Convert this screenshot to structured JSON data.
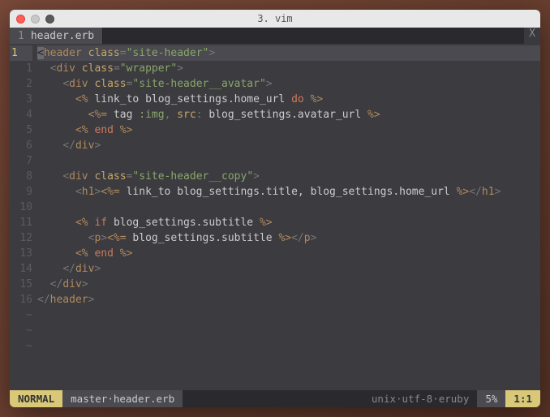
{
  "window": {
    "title": "3. vim"
  },
  "tab": {
    "index": "1",
    "filename": "header.erb",
    "close": "X"
  },
  "gutter": [
    " 1",
    " 2",
    " 3",
    " 4",
    " 5",
    " 6",
    " 7",
    " 8",
    " 9",
    "10",
    "11",
    "12",
    "13",
    "14",
    "15",
    "16"
  ],
  "cursor_gutter": "1 ",
  "code": {
    "l0": {
      "a": "<",
      "tag": "header",
      "sp": " ",
      "attr": "class",
      "eq": "=",
      "q1": "\"",
      "str": "site-header",
      "q2": "\"",
      "b": ">"
    },
    "l1": {
      "ind": "  ",
      "a": "<",
      "tag": "div",
      "sp": " ",
      "attr": "class",
      "eq": "=",
      "q1": "\"",
      "str": "wrapper",
      "q2": "\"",
      "b": ">"
    },
    "l2": {
      "ind": "    ",
      "a": "<",
      "tag": "div",
      "sp": " ",
      "attr": "class",
      "eq": "=",
      "q1": "\"",
      "str": "site-header__avatar",
      "q2": "\"",
      "b": ">"
    },
    "l3": {
      "ind": "      ",
      "o": "<%",
      "sp": " ",
      "id": "link_to blog_settings.home_url",
      "sp2": " ",
      "kw": "do",
      "sp3": " ",
      "c": "%>"
    },
    "l4": {
      "ind": "        ",
      "o": "<%=",
      "sp": " ",
      "id1": "tag",
      "sp2": " ",
      "sym": ":img",
      "comma": ",",
      "sp3": " ",
      "attr": "src",
      "colon": ":",
      "sp4": " ",
      "id2": "blog_settings.avatar_url",
      "sp5": " ",
      "c": "%>"
    },
    "l5": {
      "ind": "      ",
      "o": "<%",
      "sp": " ",
      "kw": "end",
      "sp2": " ",
      "c": "%>"
    },
    "l6": {
      "ind": "    ",
      "a": "</",
      "tag": "div",
      "b": ">"
    },
    "l7": {
      "ind": ""
    },
    "l8": {
      "ind": "    ",
      "a": "<",
      "tag": "div",
      "sp": " ",
      "attr": "class",
      "eq": "=",
      "q1": "\"",
      "str": "site-header__copy",
      "q2": "\"",
      "b": ">"
    },
    "l9": {
      "ind": "      ",
      "a": "<",
      "tag1": "h1",
      "b": ">",
      "o": "<%=",
      "sp": " ",
      "id": "link_to blog_settings.title, blog_settings.home_url",
      "sp2": " ",
      "c": "%>",
      "a2": "</",
      "tag2": "h1",
      "b2": ">"
    },
    "l10": {
      "ind": ""
    },
    "l11": {
      "ind": "      ",
      "o": "<%",
      "sp": " ",
      "kw": "if",
      "sp2": " ",
      "id": "blog_settings.subtitle",
      "sp3": " ",
      "c": "%>"
    },
    "l12": {
      "ind": "        ",
      "a": "<",
      "tag1": "p",
      "b": ">",
      "o": "<%=",
      "sp": " ",
      "id": "blog_settings.subtitle",
      "sp2": " ",
      "c": "%>",
      "a2": "</",
      "tag2": "p",
      "b2": ">"
    },
    "l13": {
      "ind": "      ",
      "o": "<%",
      "sp": " ",
      "kw": "end",
      "sp2": " ",
      "c": "%>"
    },
    "l14": {
      "ind": "    ",
      "a": "</",
      "tag": "div",
      "b": ">"
    },
    "l15": {
      "ind": "  ",
      "a": "</",
      "tag": "div",
      "b": ">"
    },
    "l16": {
      "ind": "",
      "a": "</",
      "tag": "header",
      "b": ">"
    }
  },
  "tildes": [
    "~",
    "~",
    "~"
  ],
  "status": {
    "mode": "NORMAL",
    "branch": "master",
    "sep": " · ",
    "file": "header.erb",
    "fileformat": "unix",
    "encoding": "utf-8",
    "filetype": "eruby",
    "percent": "5%",
    "position": "1:1"
  }
}
